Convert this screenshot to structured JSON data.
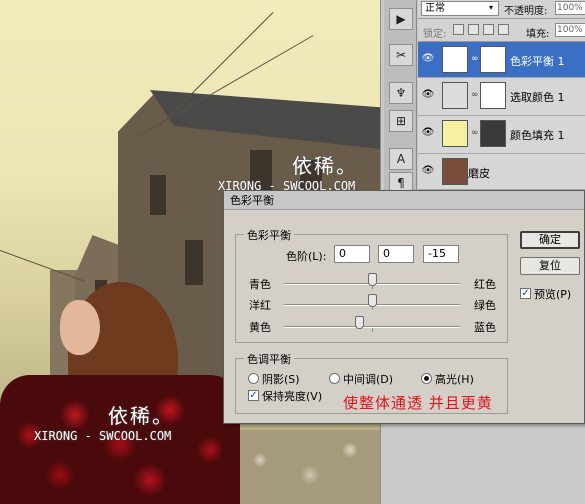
{
  "watermark": {
    "chinese": "依稀。",
    "url": "XIRONG - SWCOOL.COM"
  },
  "layers_panel": {
    "blend_mode": "正常",
    "opacity_label": "不透明度:",
    "opacity_value": "100%",
    "lock_label": "锁定:",
    "fill_label": "填充:",
    "fill_value": "100%",
    "layers": [
      {
        "name": "色彩平衡 1",
        "selected": true
      },
      {
        "name": "选取颜色 1",
        "selected": false
      },
      {
        "name": "颜色填充 1",
        "selected": false
      },
      {
        "name": "磨皮",
        "selected": false
      }
    ]
  },
  "dialog": {
    "title": "色彩平衡",
    "color_balance_group": "色彩平衡",
    "levels_label": "色阶(L):",
    "levels": [
      "0",
      "0",
      "-15"
    ],
    "sliders": [
      {
        "left": "青色",
        "right": "红色",
        "value": 0
      },
      {
        "left": "洋红",
        "right": "绿色",
        "value": 0
      },
      {
        "left": "黄色",
        "right": "蓝色",
        "value": -15
      }
    ],
    "tone_group": "色调平衡",
    "tones": [
      {
        "label": "阴影(S)",
        "checked": false
      },
      {
        "label": "中间调(D)",
        "checked": false
      },
      {
        "label": "高光(H)",
        "checked": true
      }
    ],
    "preserve_luminosity": "保持亮度(V)",
    "preserve_checked": true,
    "ok": "确定",
    "reset": "复位",
    "preview": "预览(P)",
    "preview_checked": true
  },
  "annotation": "使整体通透   并且更黄",
  "colors": {
    "selected_layer": "#3b6fc4",
    "annotation": "#e2141c"
  }
}
